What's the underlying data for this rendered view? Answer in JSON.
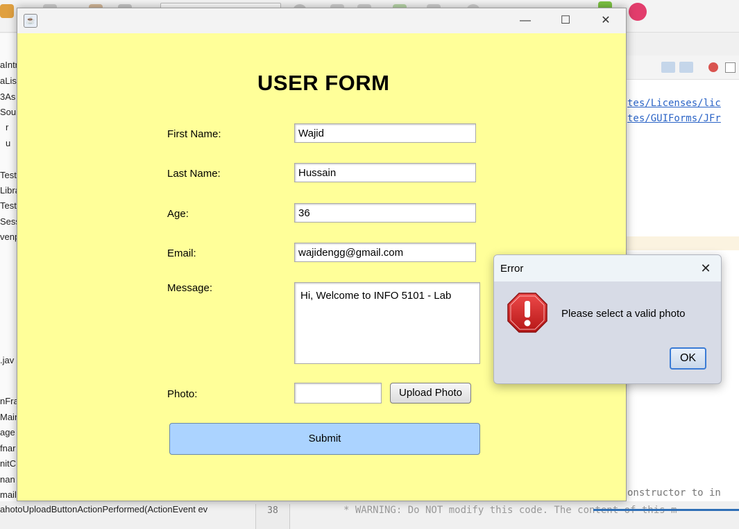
{
  "ide": {
    "left_items": [
      "aIntr",
      "aList",
      "3As",
      "Sour",
      "r",
      "u",
      "",
      "Test",
      "Libra",
      "Test",
      "Sess",
      "venp"
    ],
    "lower_left_items": [
      ".jav",
      "nFra",
      "Main",
      "age",
      "fnar",
      "nitC",
      "nan",
      "mail"
    ],
    "links": [
      "tes/Licenses/lic",
      "tes/GUIForms/JFr"
    ],
    "code_line": "onstructor to in",
    "bottom_text": "ahotoUploadButtonActionPerformed(ActionEvent ev",
    "line_no": "38",
    "bottom_code": "* WARNING: Do NOT modify this code. The content of this m"
  },
  "window": {
    "min_glyph": "—",
    "max_glyph": "☐",
    "close_glyph": "✕"
  },
  "form": {
    "title": "USER FORM",
    "first_name_label": "First Name:",
    "first_name_value": "Wajid",
    "last_name_label": "Last Name:",
    "last_name_value": "Hussain",
    "age_label": "Age:",
    "age_value": "36",
    "email_label": "Email:",
    "email_value": "wajidengg@gmail.com",
    "message_label": "Message:",
    "message_value": "Hi, Welcome to INFO 5101 - Lab",
    "photo_label": "Photo:",
    "photo_value": "",
    "upload_label": "Upload Photo",
    "submit_label": "Submit"
  },
  "dialog": {
    "title": "Error",
    "close_glyph": "✕",
    "message": "Please select a valid photo",
    "ok_label": "OK",
    "icon": "error-stop-icon",
    "icon_color": "#d42a2a"
  }
}
